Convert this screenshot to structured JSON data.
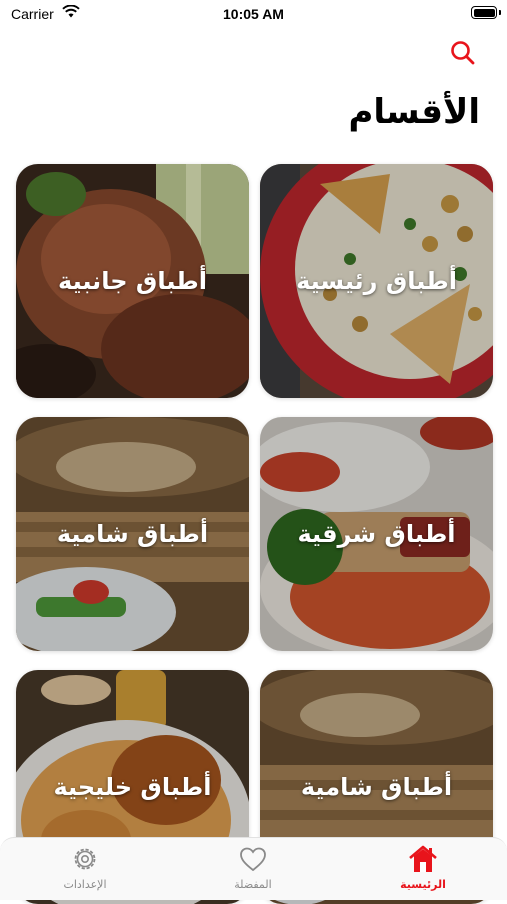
{
  "status_bar": {
    "carrier": "Carrier",
    "time": "10:05 AM"
  },
  "header": {
    "title": "الأقسام"
  },
  "categories": [
    {
      "label": "أطباق رئيسية"
    },
    {
      "label": "أطباق جانبية"
    },
    {
      "label": "أطباق شرقية"
    },
    {
      "label": "أطباق شامية"
    },
    {
      "label": "أطباق شامية"
    },
    {
      "label": "أطباق خليجية"
    }
  ],
  "tabs": {
    "home": "الرئيسية",
    "favorites": "المفضلة",
    "settings": "الإعدادات"
  },
  "colors": {
    "accent": "#e8141b",
    "inactive": "#8a8a8a"
  }
}
